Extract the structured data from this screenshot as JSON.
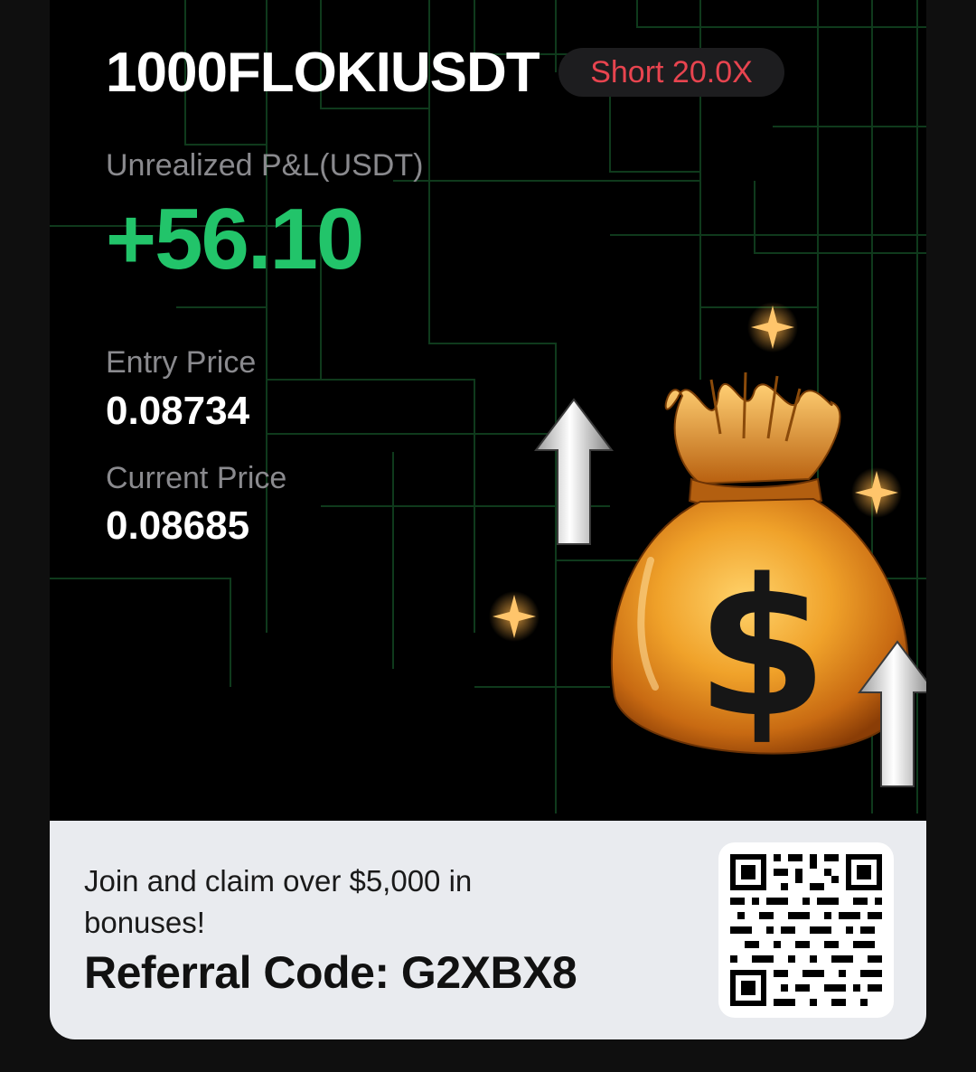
{
  "position": {
    "pair": "1000FLOKIUSDT",
    "side_label": "Short 20.0X"
  },
  "pnl": {
    "label": "Unrealized P&L(USDT)",
    "value": "+56.10"
  },
  "entry": {
    "label": "Entry Price",
    "value": "0.08734"
  },
  "current": {
    "label": "Current Price",
    "value": "0.08685"
  },
  "footer": {
    "promo_text": "Join and claim over $5,000 in bonuses!",
    "referral_text": "Referral Code: G2XBX8"
  },
  "colors": {
    "profit": "#22c46a",
    "short": "#e8444f",
    "grid": "#0f3a1c"
  },
  "icons": [
    "money-bag-icon",
    "up-arrow-icon",
    "sparkle-icon",
    "qr-code-icon"
  ]
}
